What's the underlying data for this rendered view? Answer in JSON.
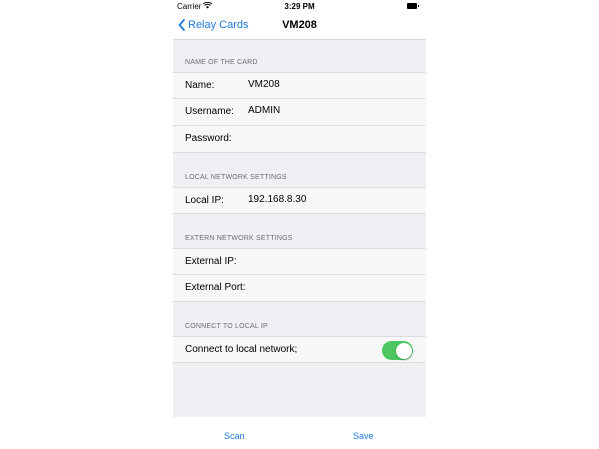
{
  "status_bar": {
    "carrier": "Carrier",
    "time": "3:29 PM"
  },
  "nav": {
    "back_label": "Relay Cards",
    "title": "VM208"
  },
  "sections": {
    "card": {
      "header": "NAME OF THE CARD",
      "name_label": "Name:",
      "name_value": "VM208",
      "username_label": "Username:",
      "username_value": "ADMIN",
      "password_label": "Password:",
      "password_value": ""
    },
    "local": {
      "header": "LOCAL NETWORK SETTINGS",
      "ip_label": "Local IP:",
      "ip_value": "192.168.8.30"
    },
    "extern": {
      "header": "EXTERN NETWORK SETTINGS",
      "ip_label": "External IP:",
      "ip_value": "",
      "port_label": "External Port:",
      "port_value": ""
    },
    "connect": {
      "header": "CONNECT TO LOCAL IP",
      "toggle_label": "Connect to local network;",
      "toggle_on": true
    }
  },
  "toolbar": {
    "scan_label": "Scan",
    "save_label": "Save"
  },
  "colors": {
    "accent": "#1f7ae0",
    "toggle_on": "#4cc760",
    "background": "#f0eff4"
  },
  "icons": {
    "back": "chevron-left-icon",
    "wifi": "wifi-icon",
    "battery": "battery-icon"
  }
}
